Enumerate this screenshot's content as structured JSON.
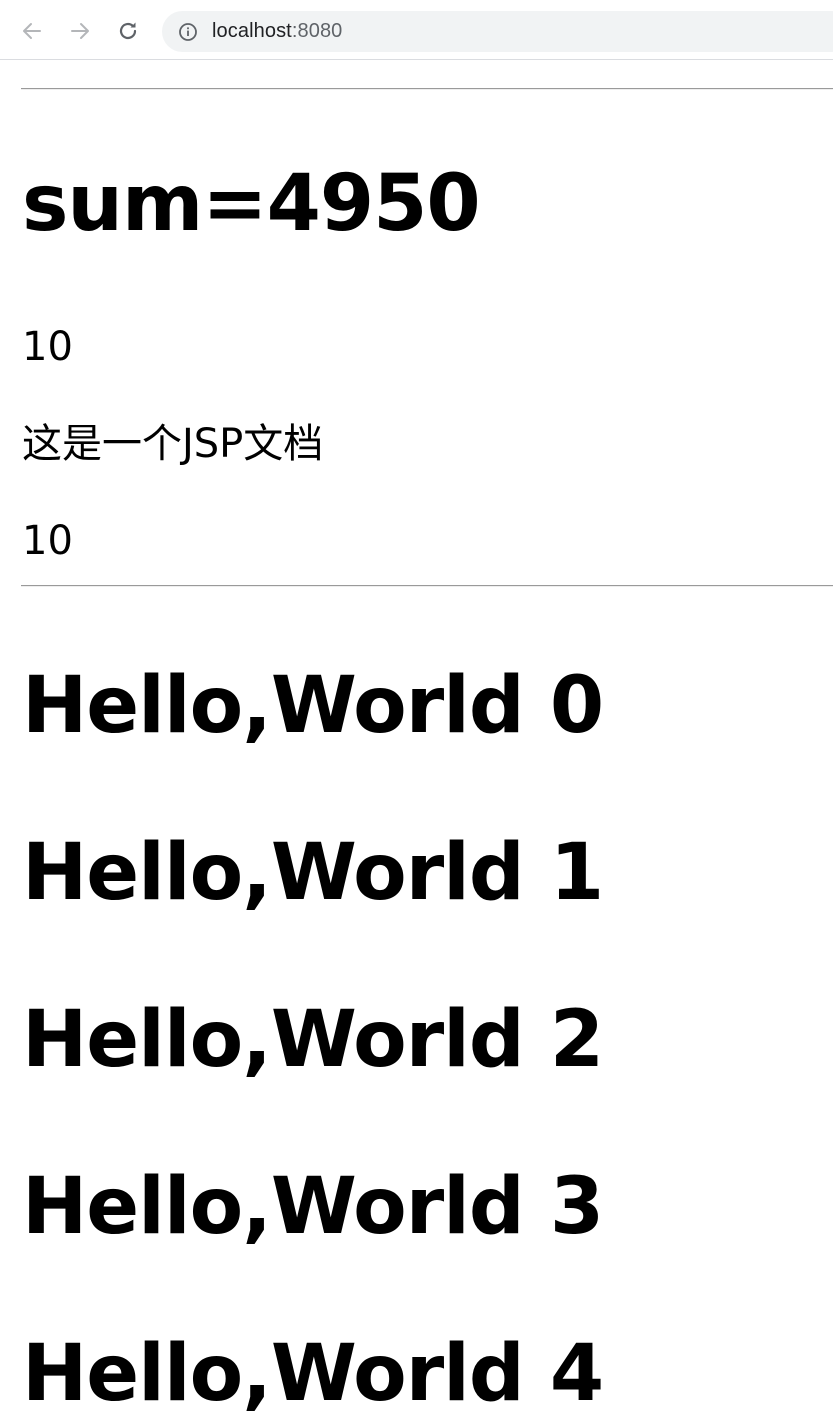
{
  "browser": {
    "url_host": "localhost",
    "url_port": ":8080",
    "icons": {
      "back": "arrow-left-icon",
      "forward": "arrow-right-icon",
      "reload": "reload-icon",
      "site_info": "info-icon"
    }
  },
  "page": {
    "sum_heading": "sum=4950",
    "value_line_1": "10",
    "doc_text": "这是一个JSP文档",
    "value_line_2": "10",
    "hello_lines": [
      "Hello,World 0",
      "Hello,World 1",
      "Hello,World 2",
      "Hello,World 3",
      "Hello,World 4"
    ]
  }
}
